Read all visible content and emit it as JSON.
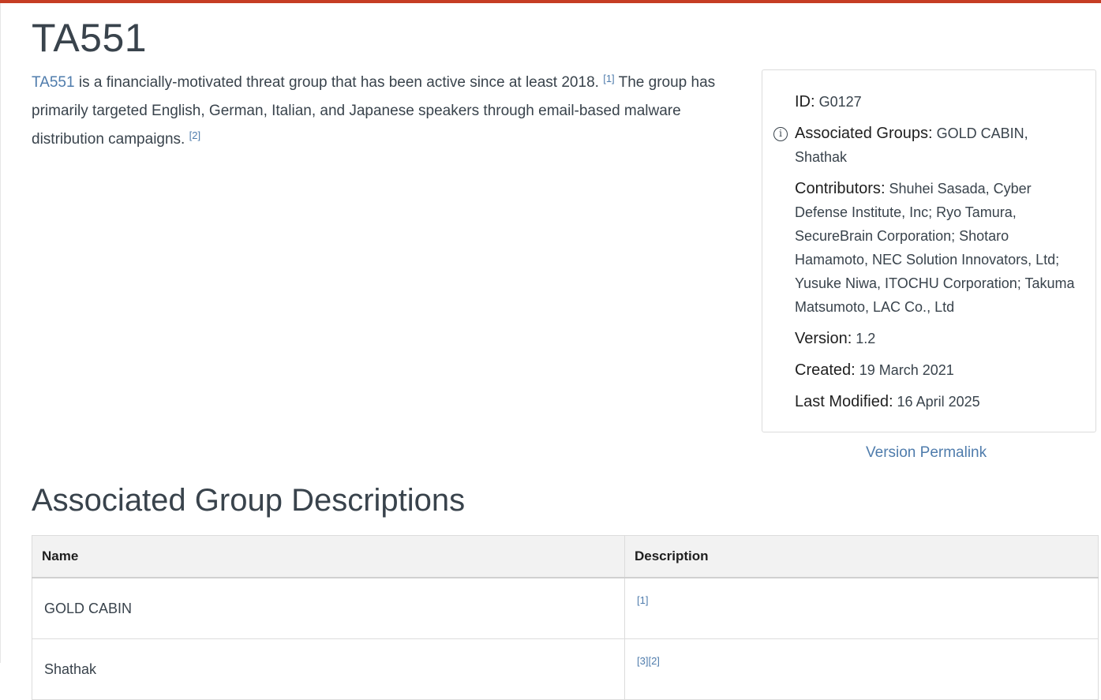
{
  "page": {
    "title": "TA551",
    "accent_color": "#c63d24",
    "link_color": "#4f7cac"
  },
  "description": {
    "link_text": "TA551",
    "text_1": " is a financially-motivated threat group that has been active since at least 2018. ",
    "ref_1": "[1]",
    "text_2": " The group has primarily targeted English, German, Italian, and Japanese speakers through email-based malware distribution campaigns. ",
    "ref_2": "[2]"
  },
  "card": {
    "id_label": "ID",
    "id_value": "G0127",
    "assoc_label": "Associated Groups",
    "assoc_value": "GOLD CABIN, Shathak",
    "info_icon": "info-icon",
    "contributors_label": "Contributors",
    "contributors_value": "Shuhei Sasada, Cyber Defense Institute, Inc; Ryo Tamura, SecureBrain Corporation; Shotaro Hamamoto, NEC Solution Innovators, Ltd; Yusuke Niwa, ITOCHU Corporation; Takuma Matsumoto, LAC Co., Ltd",
    "version_label": "Version",
    "version_value": "1.2",
    "created_label": "Created",
    "created_value": "19 March 2021",
    "modified_label": "Last Modified",
    "modified_value": "16 April 2025",
    "separator": ":"
  },
  "permalink": "Version Permalink",
  "section": {
    "title": "Associated Group Descriptions",
    "columns": [
      "Name",
      "Description"
    ],
    "rows": [
      {
        "name": "GOLD CABIN",
        "refs": [
          "[1]"
        ]
      },
      {
        "name": "Shathak",
        "refs": [
          "[3]",
          "[2]"
        ]
      }
    ]
  }
}
